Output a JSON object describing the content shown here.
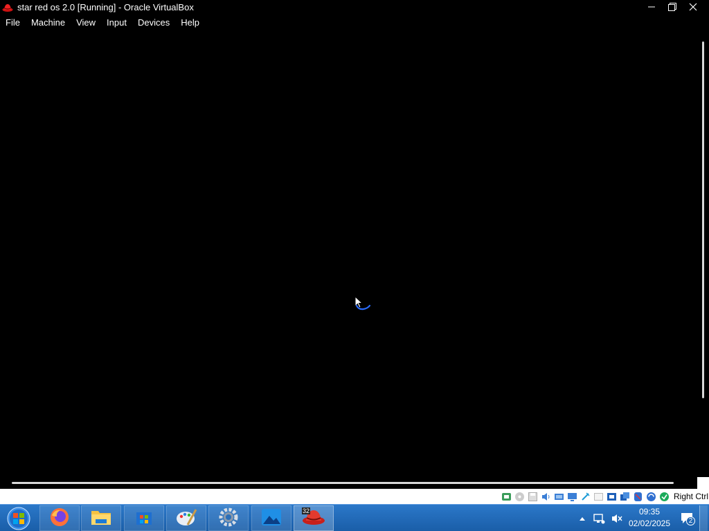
{
  "window": {
    "title": "star red os 2.0 [Running] - Oracle VirtualBox",
    "icon": "redhat-hat-icon"
  },
  "menu": [
    {
      "label": "File"
    },
    {
      "label": "Machine"
    },
    {
      "label": "View"
    },
    {
      "label": "Input"
    },
    {
      "label": "Devices"
    },
    {
      "label": "Help"
    }
  ],
  "statusbar": {
    "host_key": "Right Ctrl",
    "icons": [
      "network-icon",
      "optical-disk-icon",
      "floppy-icon",
      "audio-icon",
      "shared-folders-icon",
      "display-icon",
      "usb-icon",
      "recording-icon",
      "cpu-icon",
      "vt-x-icon",
      "mouse-integration-icon",
      "keyboard-icon"
    ]
  },
  "taskbar": {
    "apps": [
      {
        "name": "firefox",
        "icon": "firefox-icon"
      },
      {
        "name": "file-explorer",
        "icon": "folder-icon"
      },
      {
        "name": "microsoft-store",
        "icon": "store-icon"
      },
      {
        "name": "paint",
        "icon": "paint-palette-icon"
      },
      {
        "name": "settings",
        "icon": "gear-icon"
      },
      {
        "name": "photos",
        "icon": "photos-icon"
      },
      {
        "name": "virtualbox",
        "icon": "redhat-hat-icon",
        "badge": "32"
      }
    ],
    "clock": {
      "time": "09:35",
      "date": "02/02/2025"
    },
    "notifications": {
      "count": "2"
    }
  },
  "colors": {
    "taskbar": "#1f66b3",
    "vm_background": "#000000",
    "statusbar": "#ffffff"
  }
}
